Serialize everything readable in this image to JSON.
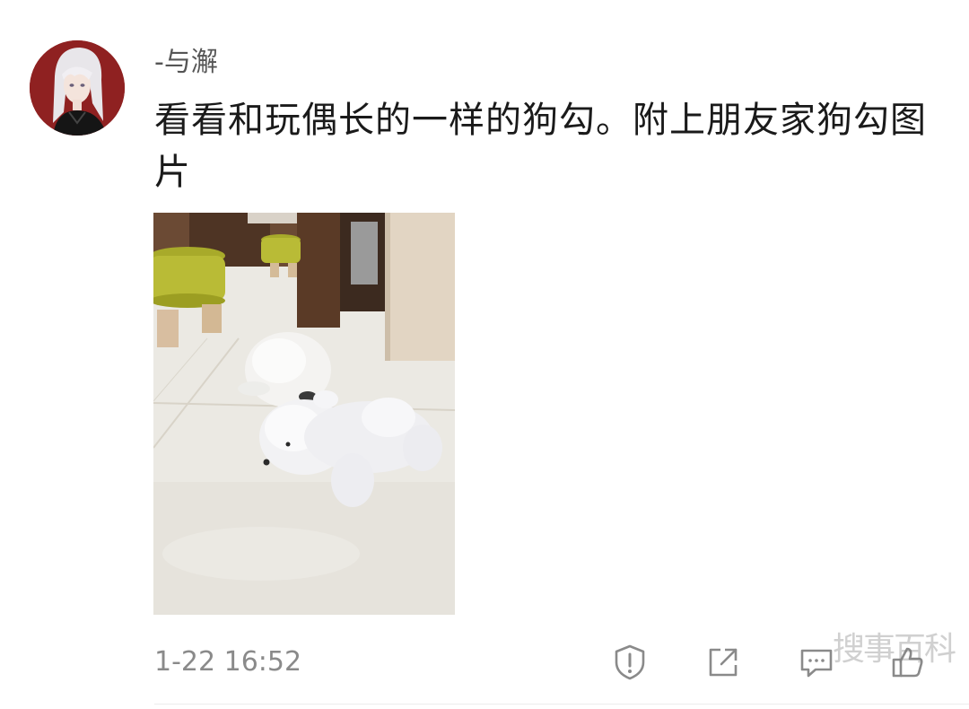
{
  "post": {
    "author": "-与澥",
    "text": "看看和玩偶长的一样的狗勾。附上朋友家狗勾图片",
    "timestamp": "1-22 16:52"
  },
  "actions": {
    "report_icon": "warning-shield-icon",
    "share_icon": "share-external-icon",
    "comment_icon": "comment-bubble-icon",
    "like_icon": "thumbs-up-icon"
  },
  "watermark": "搜事百科",
  "colors": {
    "text": "#1a1a1a",
    "secondary_text": "#8a8a8a",
    "icon": "#8a8a8a",
    "avatar_bg": "#8f2121"
  }
}
